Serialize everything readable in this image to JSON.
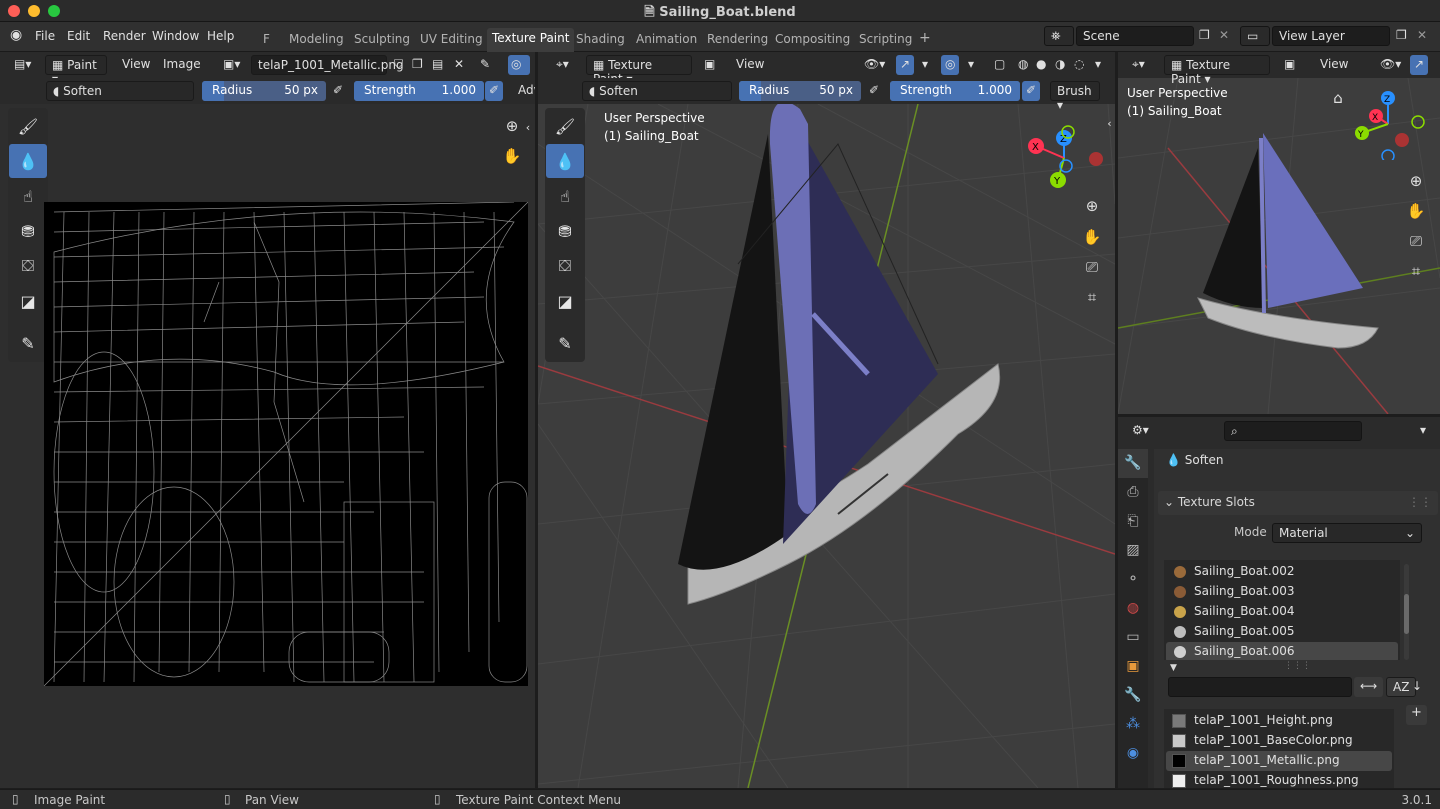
{
  "window": {
    "title": "Sailing_Boat.blend"
  },
  "menu": [
    "File",
    "Edit",
    "Render",
    "Window",
    "Help"
  ],
  "workspaces": [
    "F",
    "Modeling",
    "Sculpting",
    "UV Editing",
    "Texture Paint",
    "Shading",
    "Animation",
    "Rendering",
    "Compositing",
    "Scripting",
    "+"
  ],
  "scene": {
    "name": "Scene",
    "view_layer": "View Layer"
  },
  "image_editor": {
    "mode": "Paint",
    "menus": [
      "View",
      "Image"
    ],
    "image_name": "telaP_1001_Metallic.png",
    "brush": "Soften",
    "radius_label": "Radius",
    "radius_value": "50 px",
    "strength_label": "Strength",
    "strength_value": "1.000",
    "overflow_label": "Adv"
  },
  "viewport": {
    "mode": "Texture Paint",
    "menu": "View",
    "brush": "Soften",
    "radius_label": "Radius",
    "radius_value": "50 px",
    "strength_label": "Strength",
    "strength_value": "1.000",
    "brush_menu": "Brush",
    "perspective": "User Perspective",
    "object": "(1) Sailing_Boat"
  },
  "preview": {
    "mode": "Texture Paint",
    "menu": "View",
    "perspective": "User Perspective",
    "object": "(1) Sailing_Boat"
  },
  "properties": {
    "active_brush": "Soften",
    "panel_title": "Texture Slots",
    "mode_label": "Mode",
    "mode_value": "Material",
    "materials": [
      {
        "name": "Sailing_Boat.002",
        "color": "#9a6a3a"
      },
      {
        "name": "Sailing_Boat.003",
        "color": "#8a5b36"
      },
      {
        "name": "Sailing_Boat.004",
        "color": "#c9a34a"
      },
      {
        "name": "Sailing_Boat.005",
        "color": "#bdbdbd"
      },
      {
        "name": "Sailing_Boat.006",
        "color": "#cfcfcf"
      }
    ],
    "textures": [
      {
        "name": "telaP_1001_Height.png",
        "color": "#7a7a7a"
      },
      {
        "name": "telaP_1001_BaseColor.png",
        "color": "#c9c9c9"
      },
      {
        "name": "telaP_1001_Metallic.png",
        "color": "#000000"
      },
      {
        "name": "telaP_1001_Roughness.png",
        "color": "#eeeeee"
      }
    ],
    "sort_label": "AZ"
  },
  "status": {
    "left": "Image Paint",
    "middle": "Pan View",
    "right": "Texture Paint Context Menu",
    "version": "3.0.1"
  },
  "colors": {
    "accent": "#4772b3",
    "axis_x": "#ff3352",
    "axis_y": "#8bdc00",
    "axis_z": "#2890ff"
  }
}
